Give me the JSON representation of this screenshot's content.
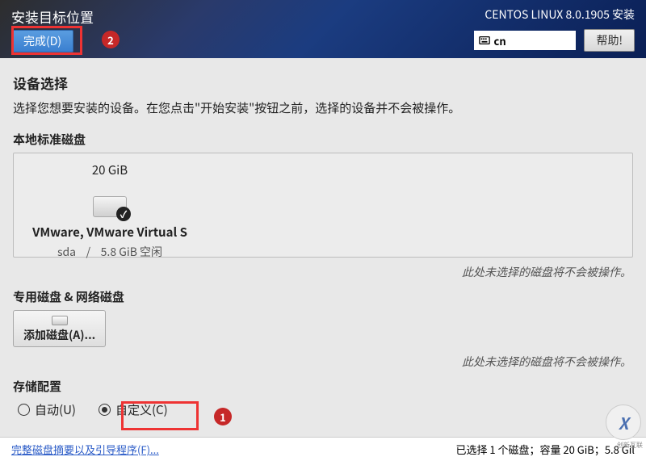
{
  "header": {
    "page_title": "安装目标位置",
    "done_button": "完成(D)",
    "install_title": "CENTOS LINUX 8.0.1905 安装",
    "lang": "cn",
    "help_button": "帮助!"
  },
  "callouts": {
    "one": "1",
    "two": "2"
  },
  "device_select": {
    "heading": "设备选择",
    "desc": "选择您想要安装的设备。在您点击\"开始安装\"按钮之前，选择的设备并不会被操作。"
  },
  "local_disks": {
    "heading": "本地标准磁盘",
    "disk": {
      "size": "20 GiB",
      "name": "VMware, VMware Virtual S",
      "dev": "sda",
      "sep": "/",
      "free": "5.8 GiB 空闲"
    },
    "hint": "此处未选择的磁盘将不会被操作。"
  },
  "special_disks": {
    "heading": "专用磁盘 & 网络磁盘",
    "add_button": "添加磁盘(A)...",
    "hint": "此处未选择的磁盘将不会被操作。"
  },
  "storage": {
    "heading": "存储配置",
    "auto": "自动(U)",
    "custom": "自定义(C)"
  },
  "footer": {
    "link": "完整磁盘摘要以及引导程序(F)...",
    "summary": "已选择 1 个磁盘；容量 20 GiB；5.8 Gil"
  },
  "watermark": {
    "main": "X",
    "sub": "创新互联"
  }
}
